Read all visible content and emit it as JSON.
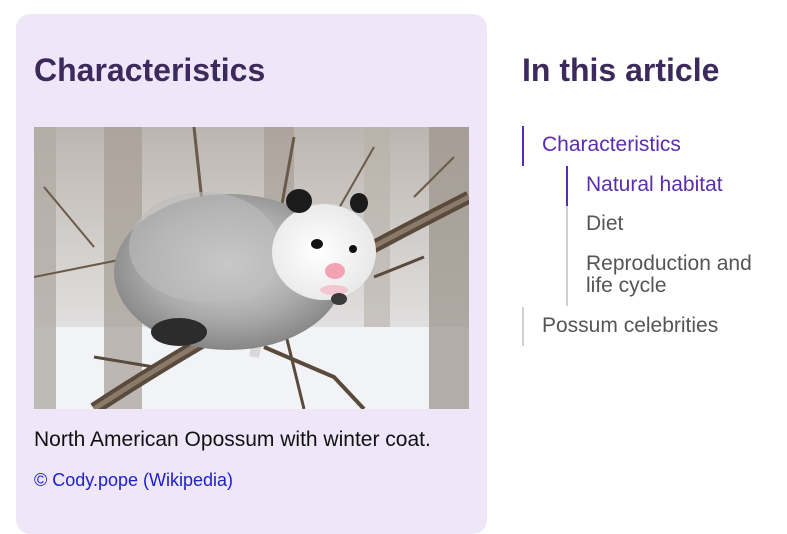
{
  "card": {
    "title": "Characteristics",
    "image_alt": "North American Opossum perched on a snowy branch",
    "caption": "North American Opossum with winter coat.",
    "credit": "© Cody.pope (Wikipedia)"
  },
  "toc": {
    "title": "In this article",
    "items": [
      {
        "label": "Characteristics",
        "active": true
      },
      {
        "label": "Natural habitat",
        "active": true
      },
      {
        "label": "Diet",
        "active": false
      },
      {
        "label": "Reproduction and life cycle",
        "active": false
      },
      {
        "label": "Possum celebrities",
        "active": false
      }
    ]
  },
  "colors": {
    "card_background": "#f0e6fa",
    "heading": "#3d2a5c",
    "active_link": "#5b2db0",
    "credit_link": "#1a22c8"
  }
}
